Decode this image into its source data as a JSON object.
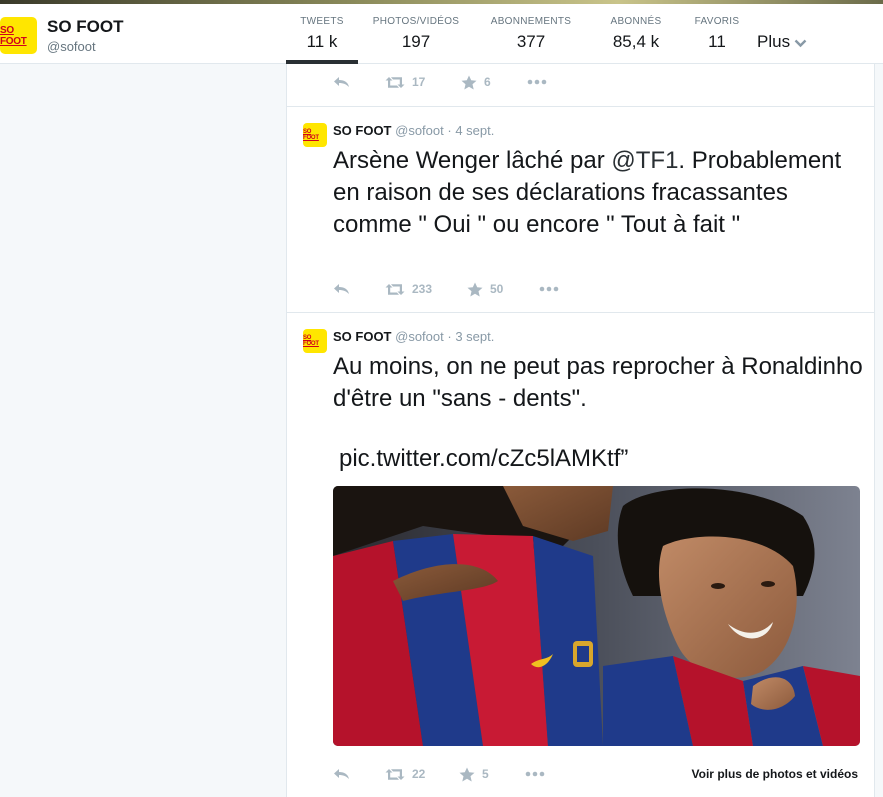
{
  "profile": {
    "name": "SO FOOT",
    "handle": "@sofoot",
    "logo_text": "SO FOOT"
  },
  "stats": [
    {
      "label": "TWEETS",
      "value": "11 k"
    },
    {
      "label": "PHOTOS/VIDÉOS",
      "value": "197"
    },
    {
      "label": "ABONNEMENTS",
      "value": "377"
    },
    {
      "label": "ABONNÉS",
      "value": "85,4 k"
    },
    {
      "label": "FAVORIS",
      "value": "11"
    }
  ],
  "more_label": "Plus",
  "tweets": [
    {
      "retweets": "17",
      "favorites": "6"
    },
    {
      "name": "SO FOOT",
      "handle": "@sofoot",
      "date": "· 4 sept.",
      "text_before": "Arsène Wenger lâché par ",
      "mention": "@TF1",
      "text_after": ". Probablement en raison de ses déclarations fracassantes comme \" Oui \" ou encore \" Tout à fait \"",
      "retweets": "233",
      "favorites": "50"
    },
    {
      "name": "SO FOOT",
      "handle": "@sofoot",
      "date": "· 3 sept.",
      "text": "Au moins, on ne peut pas reprocher à Ronaldinho d'être un \"sans - dents\".",
      "link": "pic.twitter.com/cZc5lAMKtf”",
      "retweets": "22",
      "favorites": "5",
      "more_media": "Voir plus de photos et vidéos"
    }
  ],
  "colors": {
    "logo_bg": "#ffe600",
    "logo_text": "#d0021b",
    "action_gray": "#aab8c2",
    "jersey_blue": "#1f3a8a",
    "jersey_red": "#b5122b"
  }
}
